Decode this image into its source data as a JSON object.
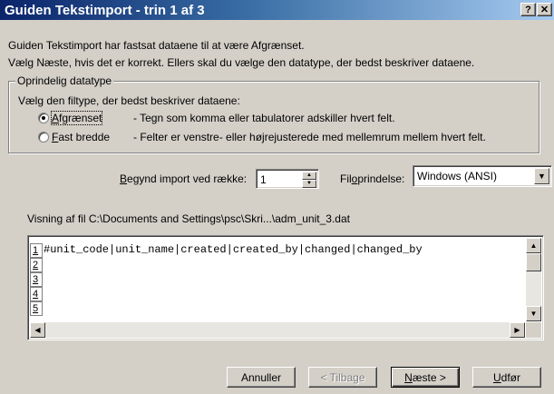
{
  "window": {
    "title": "Guiden Tekstimport - trin 1 af 3",
    "help_label": "?",
    "close_label": "✕"
  },
  "description": {
    "line1": "Guiden Tekstimport har fastsat dataene til at være Afgrænset.",
    "line2": "Vælg Næste, hvis det er korrekt. Ellers skal du vælge den datatype, der bedst beskriver dataene."
  },
  "original_data_type": {
    "legend": "Oprindelig datatype",
    "instruction": "Vælg den filtype, der bedst beskriver dataene:",
    "options": [
      {
        "label": "Afgrænset",
        "mnemonic": 0,
        "description": "- Tegn som komma eller tabulatorer adskiller hvert felt.",
        "selected": true
      },
      {
        "label": "Fast bredde",
        "mnemonic": 0,
        "description": "- Felter er venstre- eller højrejusterede med mellemrum mellem hvert felt.",
        "selected": false
      }
    ]
  },
  "import": {
    "start_row_label": "Begynd import ved række:",
    "start_row_mnemonic": 0,
    "start_row_value": "1",
    "file_origin_label": "Filoprindelse:",
    "file_origin_mnemonic": 3,
    "file_origin_value": "Windows (ANSI)"
  },
  "preview": {
    "label": "Visning af fil C:\\Documents and Settings\\psc\\Skri...\\adm_unit_3.dat",
    "row_numbers": [
      "1",
      "2",
      "3",
      "4",
      "5"
    ],
    "line1": "#unit_code|unit_name|created|created_by|changed|changed_by"
  },
  "buttons": {
    "cancel": "Annuller",
    "back": "< Tilbage",
    "next": "Næste >",
    "next_mnemonic": 0,
    "finish": "Udfør",
    "finish_mnemonic": 0
  }
}
